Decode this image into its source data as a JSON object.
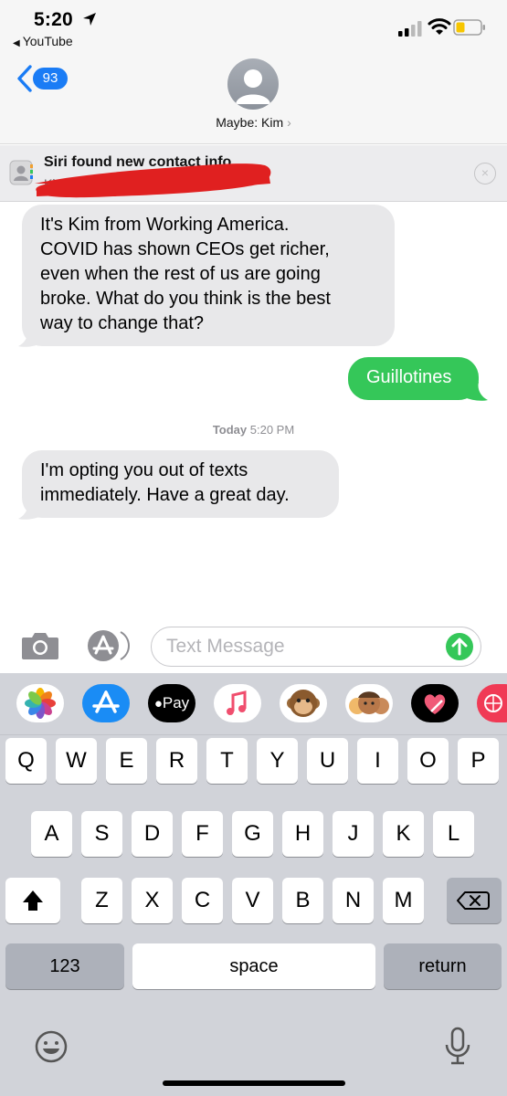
{
  "status_bar": {
    "time": "5:20",
    "back_app": "YouTube",
    "location_icon": "location-arrow-icon",
    "signal_icon": "cellular-signal-icon",
    "wifi_icon": "wifi-icon",
    "battery_icon": "battery-low-icon"
  },
  "nav": {
    "back_count": "93",
    "contact_name": "Maybe: Kim",
    "chevron": "›"
  },
  "siri_banner": {
    "title": "Siri found new contact info",
    "subtitle": "Kim +1 (5",
    "close_glyph": "×"
  },
  "messages": [
    {
      "direction": "received",
      "lines": [
        "It's Kim from Working America.",
        "COVID has shown CEOs get richer,",
        "even when the rest of us are going",
        "broke. What do you think is the best",
        "way to change that?"
      ]
    },
    {
      "direction": "sent",
      "lines": [
        "Guillotines"
      ]
    },
    {
      "direction": "received",
      "lines": [
        "I'm opting you out of texts",
        "immediately. Have a great day."
      ]
    }
  ],
  "timestamp": {
    "day": "Today",
    "time": "5:20 PM"
  },
  "composer": {
    "placeholder": "Text Message",
    "value": ""
  },
  "app_strip": [
    {
      "name": "Photos",
      "icon": "photos-icon",
      "color": "#ffffff"
    },
    {
      "name": "App Store",
      "icon": "app-store-icon",
      "color": "#1a8cf5"
    },
    {
      "name": "Apple Pay",
      "label": "Pay",
      "icon": "apple-pay-icon",
      "color": "#000000"
    },
    {
      "name": "Music",
      "icon": "music-icon",
      "color": "#ffffff"
    },
    {
      "name": "Animoji",
      "icon": "monkey-emoji-icon",
      "color": "#ffffff"
    },
    {
      "name": "Memoji",
      "icon": "memoji-icon",
      "color": "#ffffff"
    },
    {
      "name": "Digital Touch",
      "icon": "heart-touch-icon",
      "color": "#000000"
    },
    {
      "name": "Web",
      "icon": "globe-icon",
      "color": "#f03a55"
    }
  ],
  "keyboard": {
    "row1": [
      "Q",
      "W",
      "E",
      "R",
      "T",
      "Y",
      "U",
      "I",
      "O",
      "P"
    ],
    "row2": [
      "A",
      "S",
      "D",
      "F",
      "G",
      "H",
      "J",
      "K",
      "L"
    ],
    "row3": [
      "Z",
      "X",
      "C",
      "V",
      "B",
      "N",
      "M"
    ],
    "numbers_label": "123",
    "space_label": "space",
    "return_label": "return"
  },
  "colors": {
    "imessage_blue": "#1a7cf5",
    "sms_green": "#35c759",
    "received_bubble": "#e8e8ea",
    "redaction": "#e02020"
  }
}
